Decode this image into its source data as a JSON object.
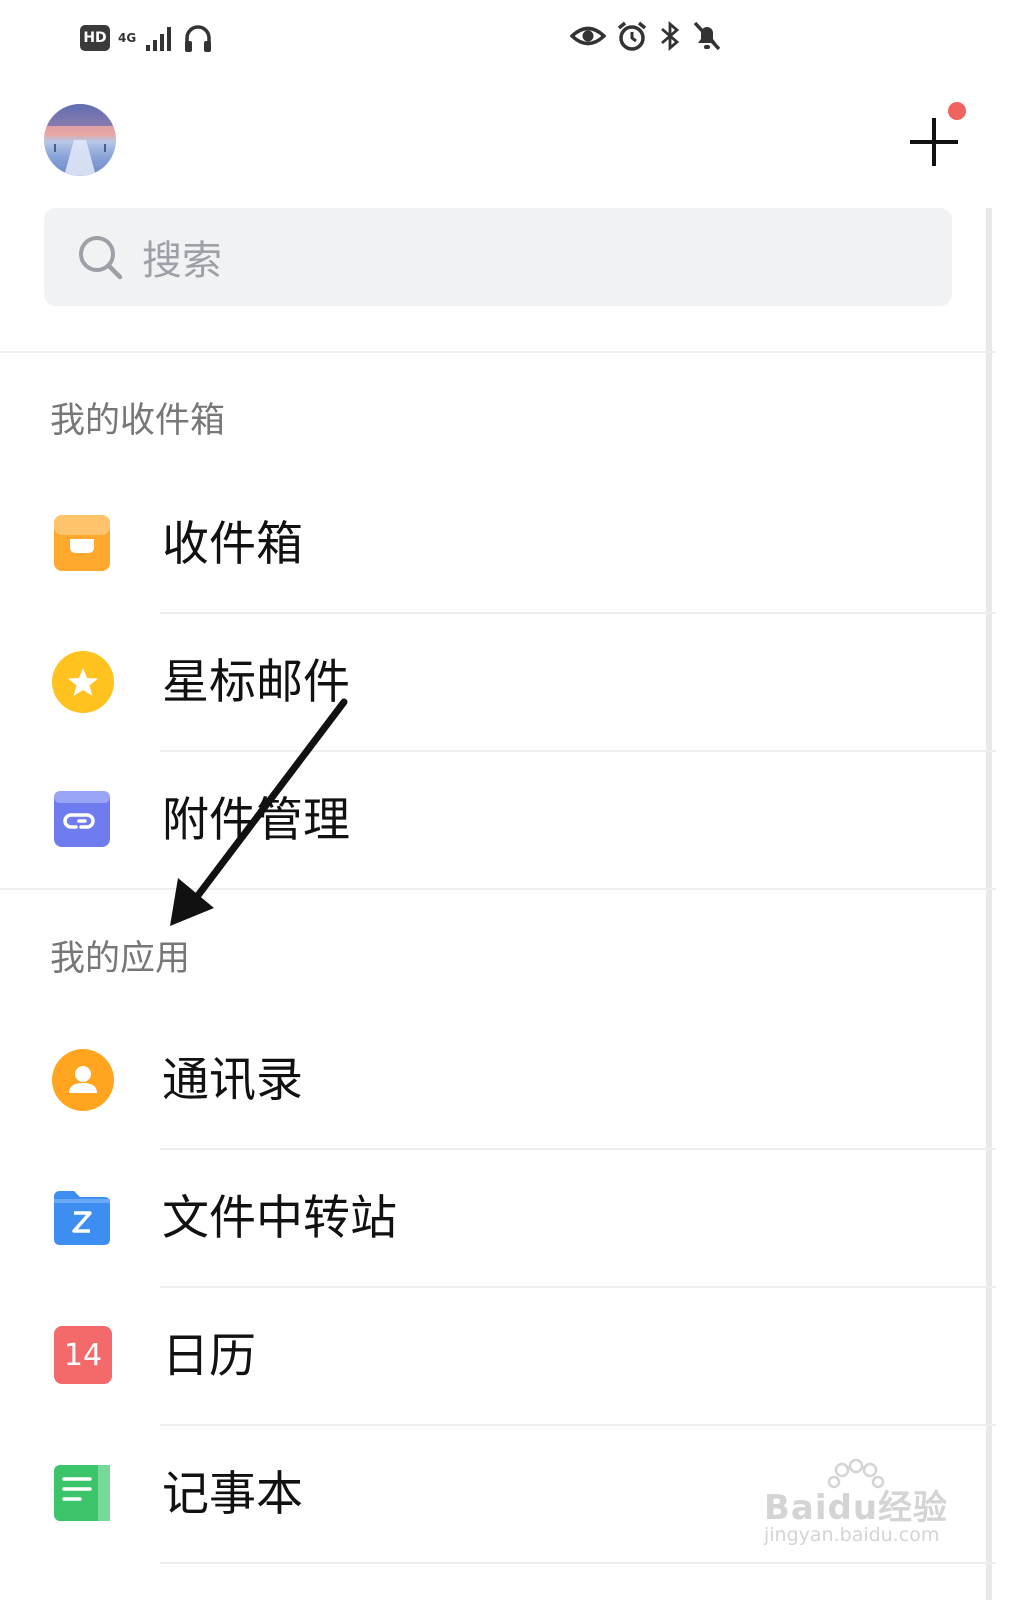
{
  "status_bar": {
    "hd_label": "HD",
    "network_label": "4G"
  },
  "search": {
    "placeholder": "搜索"
  },
  "sections": {
    "inbox_title": "我的收件箱",
    "apps_title": "我的应用"
  },
  "inbox_items": [
    {
      "label": "收件箱",
      "icon": "inbox-tray-icon",
      "color": "#ffa82e"
    },
    {
      "label": "星标邮件",
      "icon": "star-icon",
      "color": "#ffc21f"
    },
    {
      "label": "附件管理",
      "icon": "attachment-icon",
      "color": "#6f7cf0"
    }
  ],
  "app_items": [
    {
      "label": "通讯录",
      "icon": "contacts-icon",
      "color": "#ffa51f"
    },
    {
      "label": "文件中转站",
      "icon": "folder-icon",
      "color": "#3d8ef0"
    },
    {
      "label": "日历",
      "icon": "calendar-icon",
      "color": "#f46a6a",
      "badge": "14"
    },
    {
      "label": "记事本",
      "icon": "notepad-icon",
      "color": "#3cc46b"
    }
  ],
  "colors": {
    "notification_dot": "#f0625d",
    "search_bg": "#f1f2f4"
  },
  "watermark": {
    "logo": "Baidu经验",
    "url": "jingyan.baidu.com"
  }
}
